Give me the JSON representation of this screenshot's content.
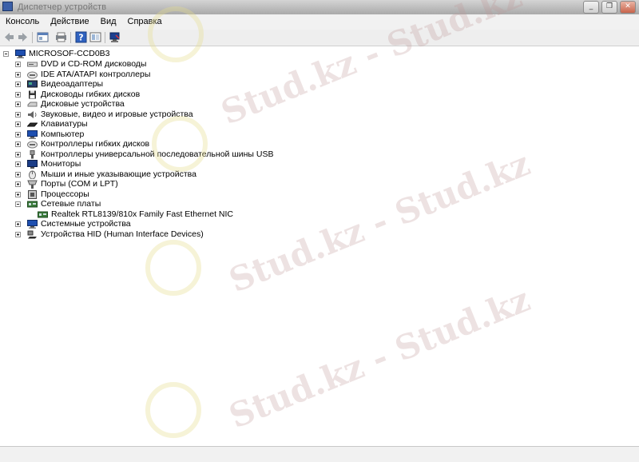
{
  "window": {
    "title": "Диспетчер устройств",
    "buttons": {
      "minimize": "_",
      "maximize": "❐",
      "close": "✕"
    }
  },
  "menu": {
    "items": [
      "Консоль",
      "Действие",
      "Вид",
      "Справка"
    ]
  },
  "toolbar": {
    "icons": [
      "back-icon",
      "forward-icon",
      "console-tree-icon",
      "print-icon",
      "help-icon",
      "properties-icon",
      "scan-hardware-icon"
    ]
  },
  "tree": {
    "root": {
      "label": "MICROSOF-CCD0B3",
      "icon": "computer-icon"
    },
    "categories": [
      {
        "label": "DVD и CD-ROM дисководы",
        "icon": "cdrom-icon",
        "expanded": false
      },
      {
        "label": "IDE ATA/ATAPI контроллеры",
        "icon": "ide-controller-icon",
        "expanded": false
      },
      {
        "label": "Видеоадаптеры",
        "icon": "display-adapter-icon",
        "expanded": false
      },
      {
        "label": "Дисководы гибких дисков",
        "icon": "floppy-icon",
        "expanded": false
      },
      {
        "label": "Дисковые устройства",
        "icon": "disk-icon",
        "expanded": false
      },
      {
        "label": "Звуковые, видео и игровые устройства",
        "icon": "sound-icon",
        "expanded": false
      },
      {
        "label": "Клавиатуры",
        "icon": "keyboard-icon",
        "expanded": false
      },
      {
        "label": "Компьютер",
        "icon": "computer-icon",
        "expanded": false
      },
      {
        "label": "Контроллеры гибких дисков",
        "icon": "floppy-controller-icon",
        "expanded": false
      },
      {
        "label": "Контроллеры универсальной последовательной шины USB",
        "icon": "usb-icon",
        "expanded": false
      },
      {
        "label": "Мониторы",
        "icon": "monitor-icon",
        "expanded": false
      },
      {
        "label": "Мыши и иные указывающие устройства",
        "icon": "mouse-icon",
        "expanded": false
      },
      {
        "label": "Порты (COM и LPT)",
        "icon": "port-icon",
        "expanded": false
      },
      {
        "label": "Процессоры",
        "icon": "processor-icon",
        "expanded": false
      },
      {
        "label": "Сетевые платы",
        "icon": "network-adapter-icon",
        "expanded": true,
        "children": [
          {
            "label": "Realtek RTL8139/810x Family Fast Ethernet NIC",
            "icon": "network-card-icon"
          }
        ]
      },
      {
        "label": "Системные устройства",
        "icon": "system-device-icon",
        "expanded": false
      },
      {
        "label": "Устройства HID (Human Interface Devices)",
        "icon": "hid-icon",
        "expanded": false
      }
    ]
  },
  "watermark": {
    "text": "Stud.kz - Stud.kz"
  }
}
